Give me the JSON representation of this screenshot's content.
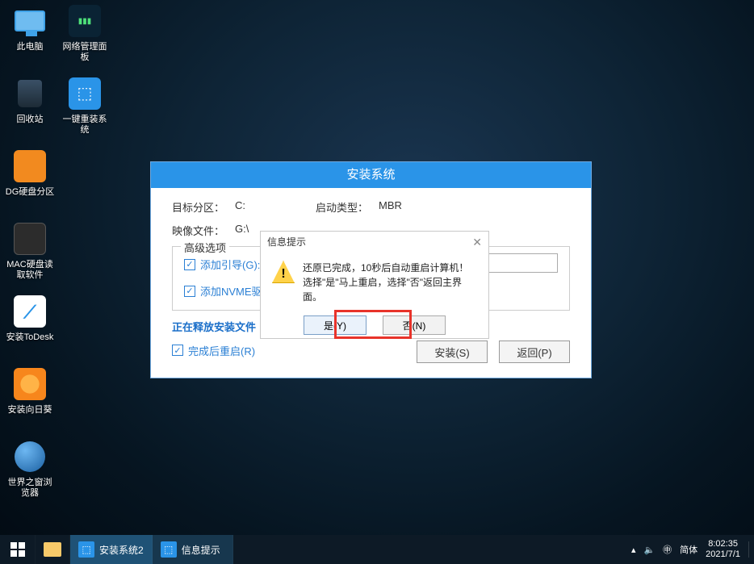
{
  "desktop": {
    "col1": [
      {
        "label": "此电脑",
        "icon": "monitor"
      },
      {
        "label": "回收站",
        "icon": "bin"
      },
      {
        "label": "DG硬盘分区",
        "icon": "orange"
      },
      {
        "label": "MAC硬盘读取软件",
        "icon": "dark"
      },
      {
        "label": "安装ToDesk",
        "icon": "white"
      },
      {
        "label": "安装向日葵",
        "icon": "sun"
      },
      {
        "label": "世界之窗浏览器",
        "icon": "globe"
      }
    ],
    "col2": [
      {
        "label": "网络管理面板",
        "icon": "blue"
      },
      {
        "label": "一键重装系统",
        "icon": "blue"
      }
    ]
  },
  "installer": {
    "title": "安装系统",
    "target_label": "目标分区：",
    "target_value": "C:",
    "boot_label": "启动类型：",
    "boot_value": "MBR",
    "image_label": "映像文件：",
    "image_value": "G:\\",
    "advanced_legend": "高级选项",
    "chk_boot": "添加引导(G):",
    "chk_nvme": "添加NVME驱",
    "progress_label": "正在释放安装文件",
    "chk_restart": "完成后重启(R)",
    "btn_install": "安装(S)",
    "btn_back": "返回(P)"
  },
  "modal": {
    "title": "信息提示",
    "line1": "还原已完成，10秒后自动重启计算机！",
    "line2": "选择\"是\"马上重启，选择\"否\"返回主界面。",
    "btn_yes": "是(Y)",
    "btn_no": "否(N)",
    "warn_glyph": "!"
  },
  "taskbar": {
    "apps": [
      {
        "label": "安装系统2"
      },
      {
        "label": "信息提示"
      }
    ],
    "ime": "简体",
    "time": "8:02:35",
    "date": "2021/7/1",
    "sound_icon": "🔈",
    "ime_icon": "㊥",
    "chevron": "▴"
  }
}
